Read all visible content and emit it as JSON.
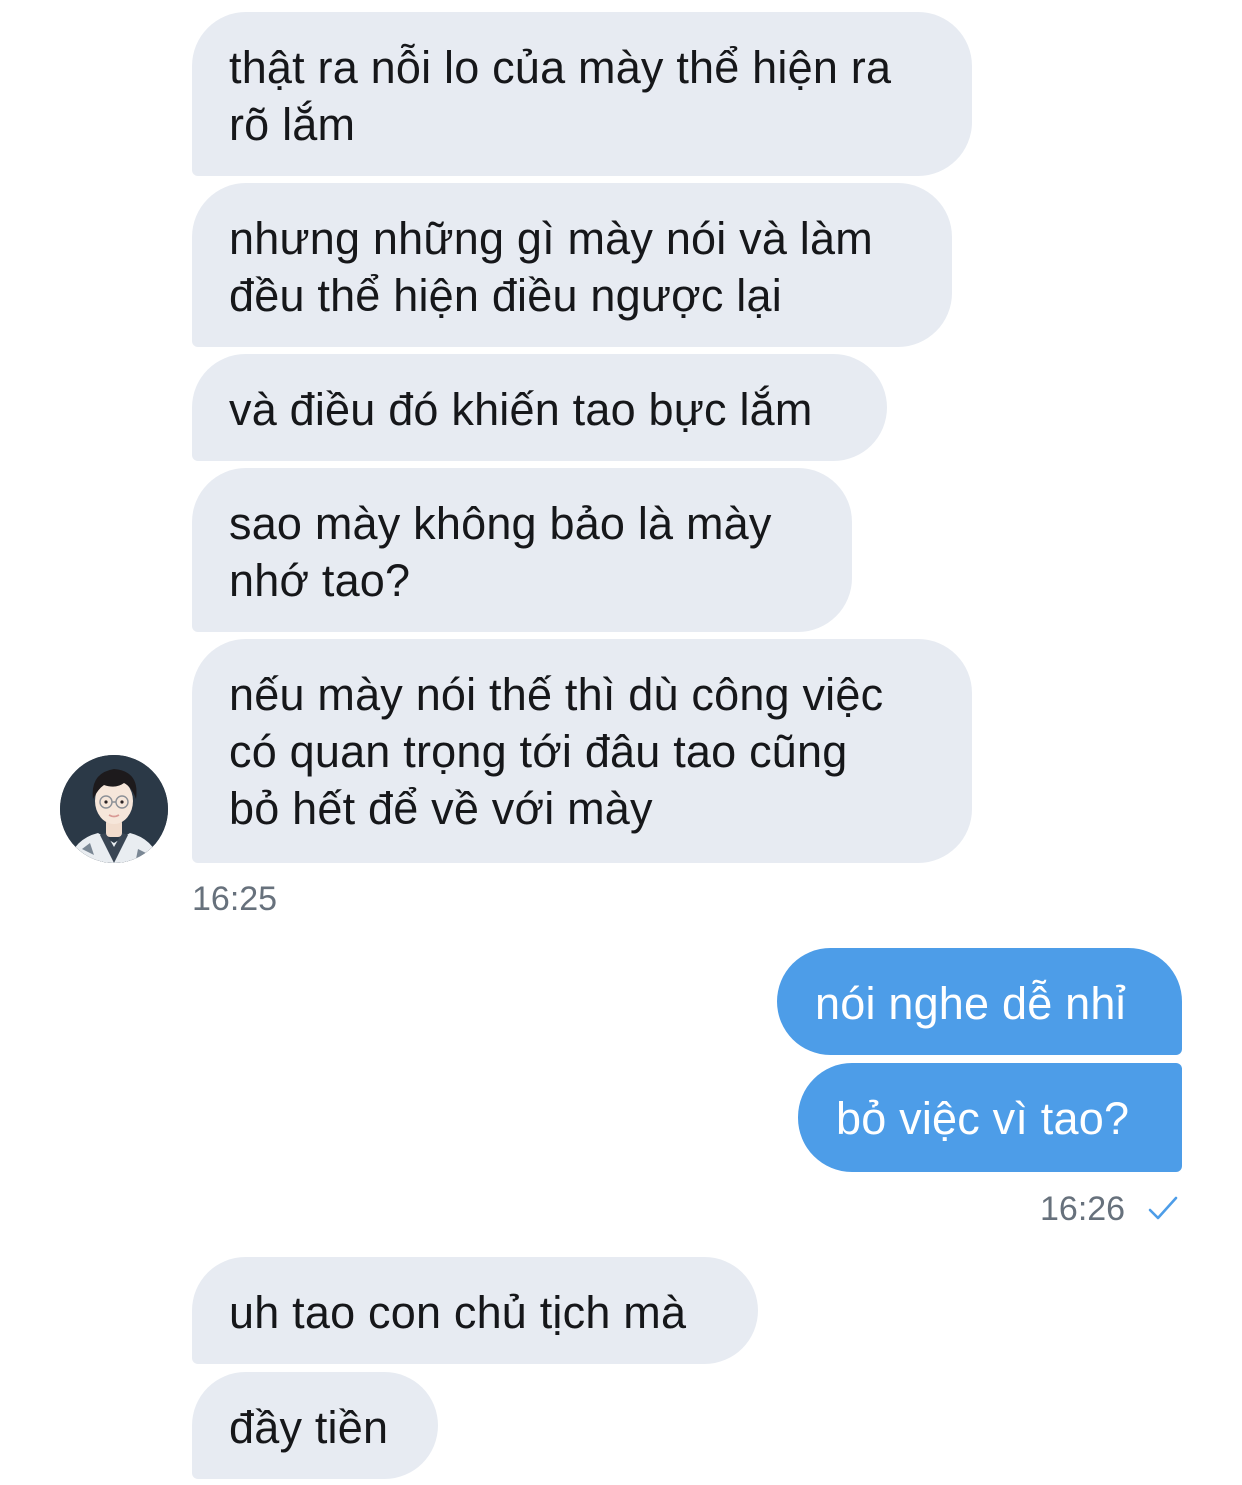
{
  "conversation": {
    "group_incoming_1": {
      "messages": [
        "thật ra nỗi lo của mày thể hiện ra\nrõ lắm",
        "nhưng những gì mày nói và làm\nđều thể hiện điều ngược lại",
        "và điều đó khiến tao bực lắm",
        "sao mày không bảo là mày\nnhớ tao?",
        "nếu mày nói thế thì dù công việc\ncó quan trọng tới đâu tao cũng\nbỏ hết để về với mày"
      ],
      "time": "16:25"
    },
    "group_outgoing_1": {
      "messages": [
        "nói nghe dễ nhỉ",
        "bỏ việc vì tao?"
      ],
      "time": "16:26",
      "status_icon": "check-icon"
    },
    "group_incoming_2": {
      "messages": [
        "uh tao con chủ tịch mà",
        "đầy tiền"
      ]
    }
  },
  "colors": {
    "incoming_bubble": "#e7ebf2",
    "outgoing_bubble": "#4d9de8",
    "timestamp": "#67717c",
    "read_check": "#4d9de8"
  },
  "avatar_icon": "contact-avatar"
}
